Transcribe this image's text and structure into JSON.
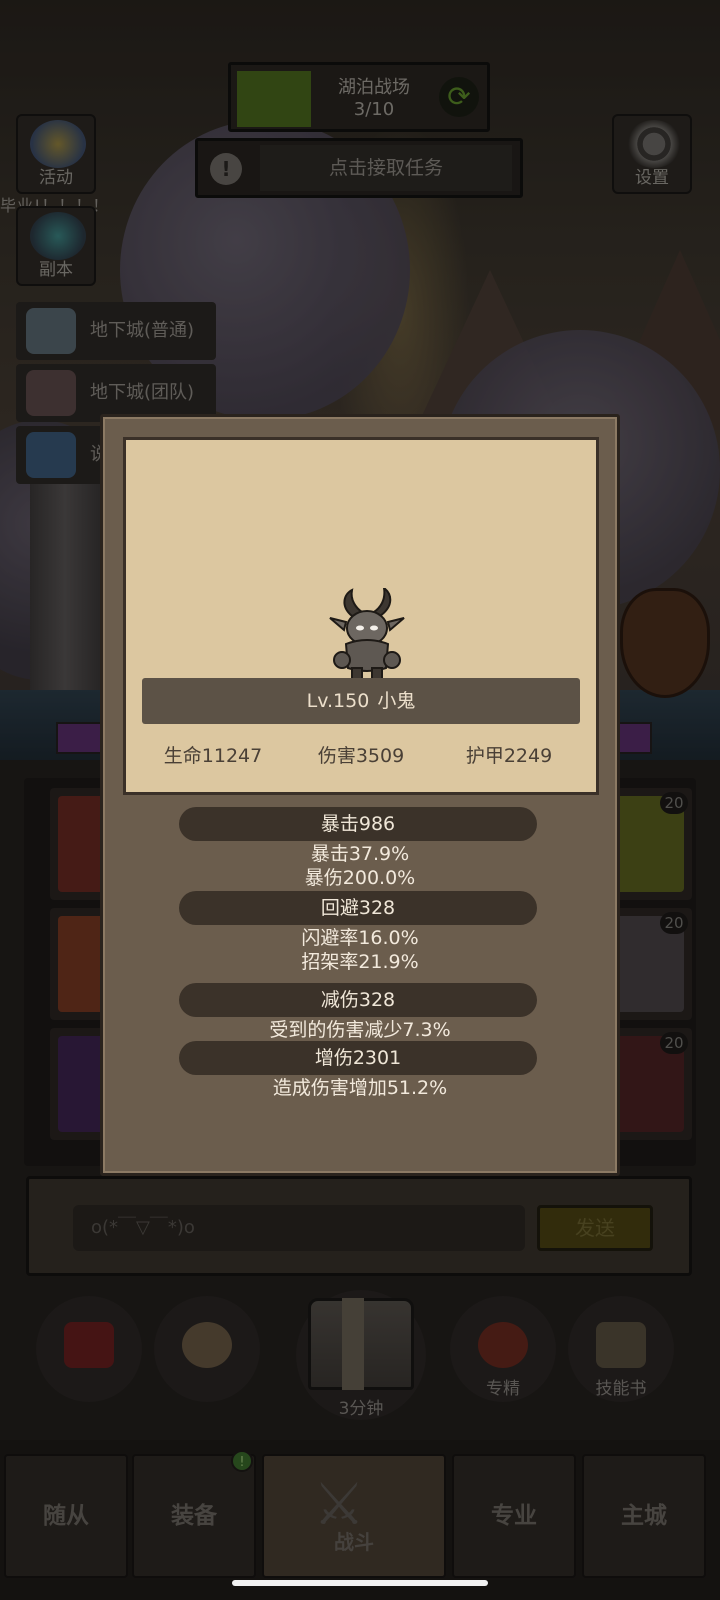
{
  "hud": {
    "stage_name": "湖泊战场",
    "stage_progress": "3/10",
    "task_text": "点击接取任务",
    "settings_label": "设置",
    "activity_label": "活动",
    "dungeon_label": "副本",
    "notice_text": "毕业!！！！！",
    "dungeon_normal": "地下城(普通)",
    "dungeon_team": "地下城(团队)",
    "dungeon_third": "说"
  },
  "modal": {
    "level": "Lv.150",
    "monster_name": "小鬼",
    "stats": [
      {
        "label": "生命",
        "value": "11247"
      },
      {
        "label": "伤害",
        "value": "3509"
      },
      {
        "label": "护甲",
        "value": "2249"
      }
    ],
    "sections": [
      {
        "title": "暴击986",
        "lines": [
          "暴击37.9%",
          "暴伤200.0%"
        ]
      },
      {
        "title": "回避328",
        "lines": [
          "闪避率16.0%",
          "招架率21.9%"
        ]
      },
      {
        "title": "减伤328",
        "lines": [
          "受到的伤害减少7.3%"
        ]
      },
      {
        "title": "增伤2301",
        "lines": [
          "造成伤害增加51.2%"
        ]
      }
    ]
  },
  "slots": [
    {
      "level": "20"
    },
    {
      "level": "20"
    },
    {
      "level": "20"
    }
  ],
  "chat": {
    "placeholder": "o(*￣▽￣*)o",
    "send_label": "发送"
  },
  "actions": {
    "chest_timer": "3分钟",
    "specialize_label": "专精",
    "skillbook_label": "技能书"
  },
  "nav": {
    "followers": "随从",
    "equipment": "装备",
    "battle": "战斗",
    "profession": "专业",
    "main_city": "主城",
    "equipment_badge": "!"
  },
  "colors": {
    "modal_bg": "#6b5d4d",
    "portrait_bg": "#dcc7a0",
    "section_bar": "#3b3229",
    "stage_green": "#4c6a1e"
  }
}
